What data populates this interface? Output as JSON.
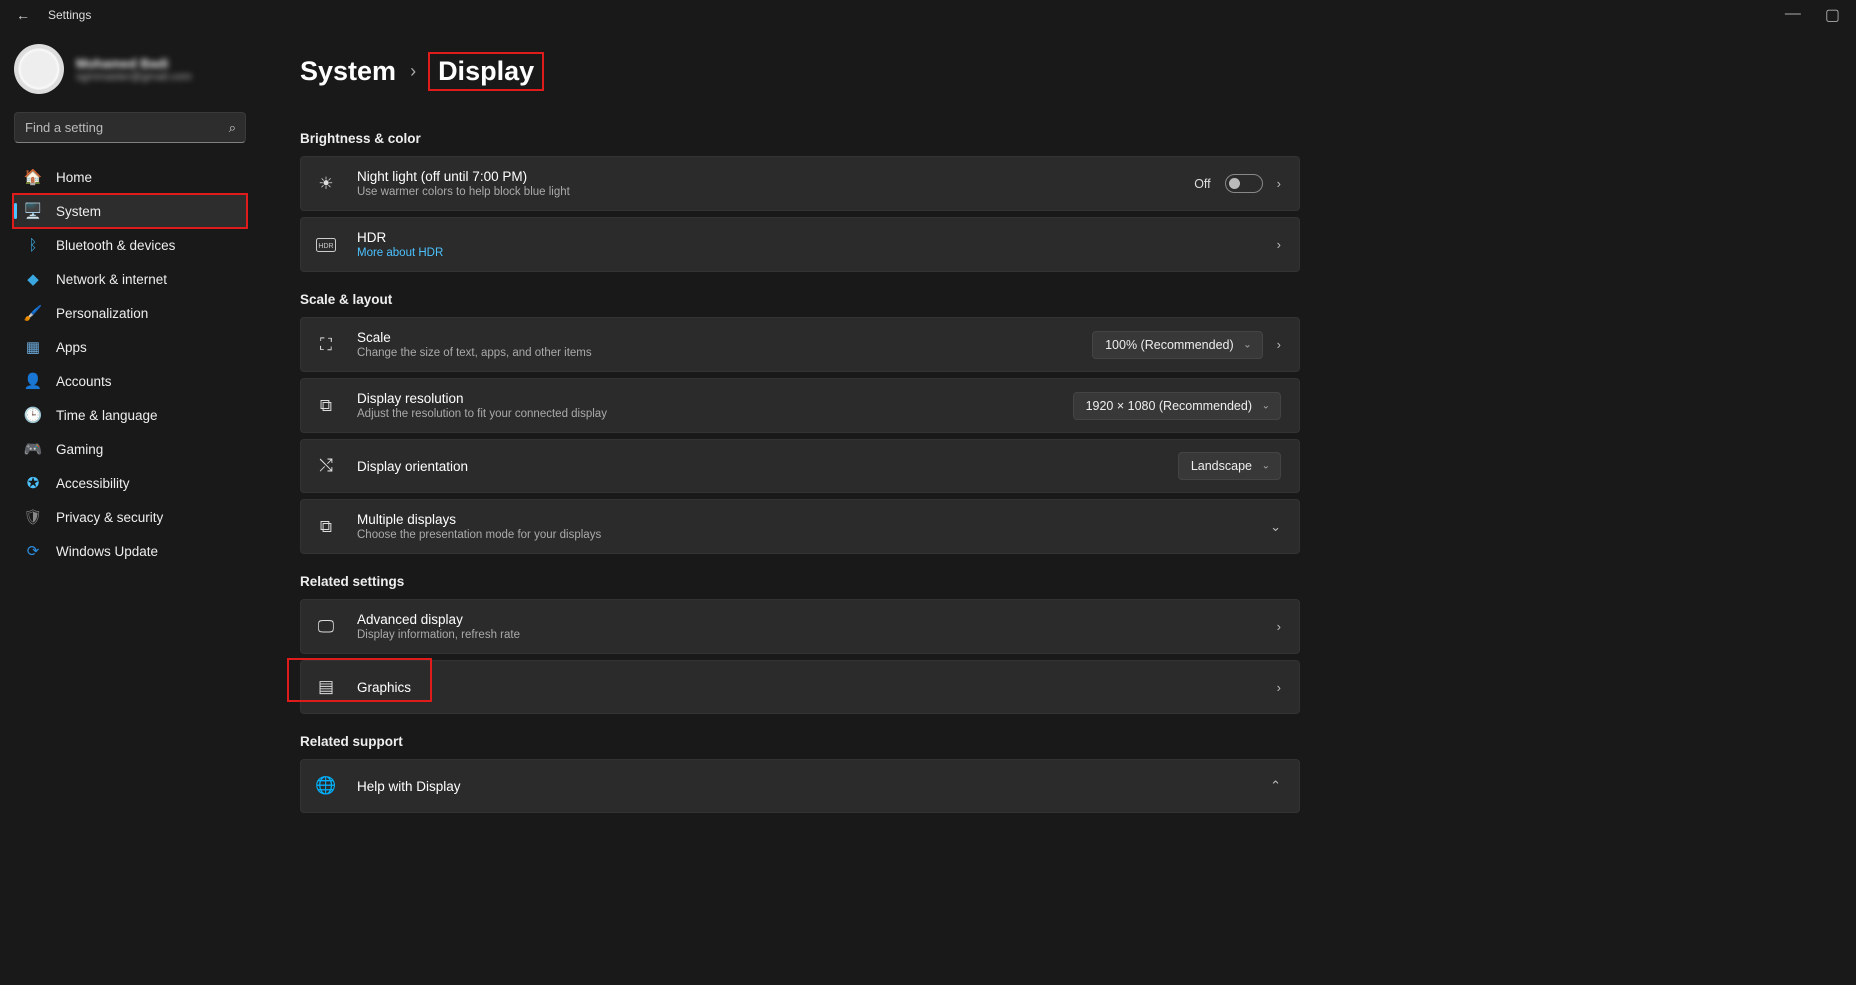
{
  "titlebar": {
    "title": "Settings"
  },
  "user": {
    "name": "Mohamed Badi",
    "email": "sgmmaster@gmail.com"
  },
  "search": {
    "placeholder": "Find a setting"
  },
  "nav": [
    {
      "icon": "🏠",
      "label": "Home",
      "name": "nav-home"
    },
    {
      "icon": "🖥️",
      "label": "System",
      "name": "nav-system",
      "active": true,
      "highlight": true,
      "iconColor": "#3aa7e0"
    },
    {
      "icon": "ᛒ",
      "label": "Bluetooth & devices",
      "name": "nav-bluetooth",
      "iconColor": "#3aa7e0"
    },
    {
      "icon": "◆",
      "label": "Network & internet",
      "name": "nav-network",
      "iconColor": "#3aa7e0"
    },
    {
      "icon": "🖌️",
      "label": "Personalization",
      "name": "nav-personalization"
    },
    {
      "icon": "▦",
      "label": "Apps",
      "name": "nav-apps",
      "iconColor": "#6aa6d6"
    },
    {
      "icon": "👤",
      "label": "Accounts",
      "name": "nav-accounts",
      "iconColor": "#4cc28a"
    },
    {
      "icon": "🕒",
      "label": "Time & language",
      "name": "nav-time",
      "iconColor": "#6aa6d6"
    },
    {
      "icon": "🎮",
      "label": "Gaming",
      "name": "nav-gaming",
      "iconColor": "#888"
    },
    {
      "icon": "✪",
      "label": "Accessibility",
      "name": "nav-accessibility",
      "iconColor": "#4cc2ff"
    },
    {
      "icon": "🛡",
      "label": "Privacy & security",
      "name": "nav-privacy",
      "iconColor": "#888"
    },
    {
      "icon": "⟳",
      "label": "Windows Update",
      "name": "nav-update",
      "iconColor": "#2c8ee0"
    }
  ],
  "breadcrumb": {
    "parent": "System",
    "current": "Display"
  },
  "sections": {
    "brightness": {
      "title": "Brightness & color",
      "nightlight": {
        "title": "Night light (off until 7:00 PM)",
        "sub": "Use warmer colors to help block blue light",
        "state": "Off"
      },
      "hdr": {
        "title": "HDR",
        "sub": "More about HDR"
      }
    },
    "scale": {
      "title": "Scale & layout",
      "scale": {
        "title": "Scale",
        "sub": "Change the size of text, apps, and other items",
        "value": "100% (Recommended)"
      },
      "resolution": {
        "title": "Display resolution",
        "sub": "Adjust the resolution to fit your connected display",
        "value": "1920 × 1080 (Recommended)"
      },
      "orientation": {
        "title": "Display orientation",
        "value": "Landscape"
      },
      "multiple": {
        "title": "Multiple displays",
        "sub": "Choose the presentation mode for your displays"
      }
    },
    "related": {
      "title": "Related settings",
      "advanced": {
        "title": "Advanced display",
        "sub": "Display information, refresh rate"
      },
      "graphics": {
        "title": "Graphics"
      }
    },
    "support": {
      "title": "Related support",
      "help": {
        "title": "Help with Display"
      }
    }
  }
}
